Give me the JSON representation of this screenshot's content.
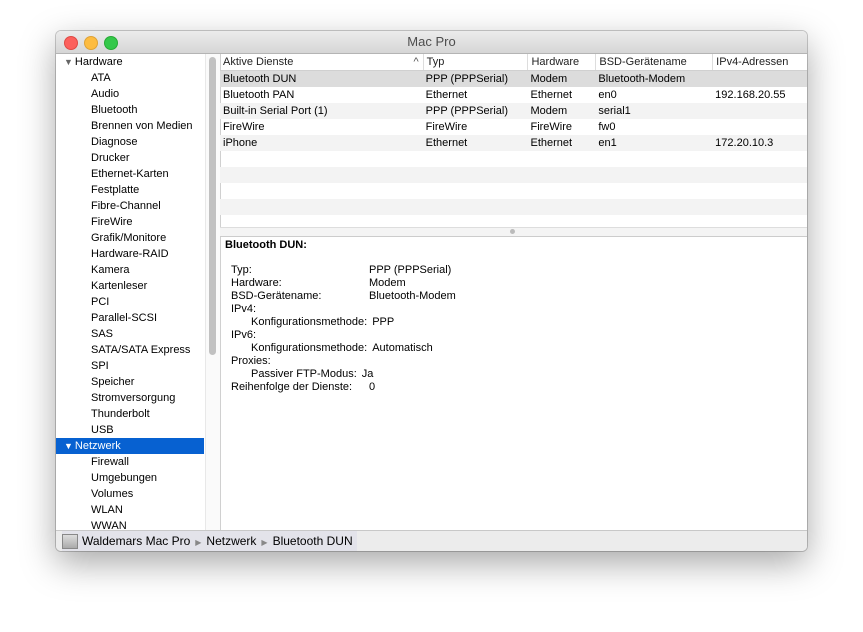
{
  "window": {
    "title": "Mac Pro"
  },
  "sidebar": {
    "items": [
      {
        "label": "Hardware",
        "cat": true
      },
      {
        "label": "ATA"
      },
      {
        "label": "Audio"
      },
      {
        "label": "Bluetooth"
      },
      {
        "label": "Brennen von Medien"
      },
      {
        "label": "Diagnose"
      },
      {
        "label": "Drucker"
      },
      {
        "label": "Ethernet-Karten"
      },
      {
        "label": "Festplatte"
      },
      {
        "label": "Fibre-Channel"
      },
      {
        "label": "FireWire"
      },
      {
        "label": "Grafik/Monitore"
      },
      {
        "label": "Hardware-RAID"
      },
      {
        "label": "Kamera"
      },
      {
        "label": "Kartenleser"
      },
      {
        "label": "PCI"
      },
      {
        "label": "Parallel-SCSI"
      },
      {
        "label": "SAS"
      },
      {
        "label": "SATA/SATA Express"
      },
      {
        "label": "SPI"
      },
      {
        "label": "Speicher"
      },
      {
        "label": "Stromversorgung"
      },
      {
        "label": "Thunderbolt"
      },
      {
        "label": "USB"
      },
      {
        "label": "Netzwerk",
        "cat": true,
        "selected": true
      },
      {
        "label": "Firewall"
      },
      {
        "label": "Umgebungen"
      },
      {
        "label": "Volumes"
      },
      {
        "label": "WLAN"
      },
      {
        "label": "WWAN"
      }
    ]
  },
  "table": {
    "headers": [
      "Aktive Dienste",
      "Typ",
      "Hardware",
      "BSD-Gerätename",
      "IPv4-Adressen"
    ],
    "rows": [
      [
        "Bluetooth DUN",
        "PPP (PPPSerial)",
        "Modem",
        "Bluetooth-Modem",
        ""
      ],
      [
        "Bluetooth PAN",
        "Ethernet",
        "Ethernet",
        "en0",
        "192.168.20.55"
      ],
      [
        "Built-in Serial Port (1)",
        "PPP (PPPSerial)",
        "Modem",
        "serial1",
        ""
      ],
      [
        "FireWire",
        "FireWire",
        "FireWire",
        "fw0",
        ""
      ],
      [
        "iPhone",
        "Ethernet",
        "Ethernet",
        "en1",
        "172.20.10.3"
      ]
    ]
  },
  "detail": {
    "title": "Bluetooth DUN:",
    "lines": [
      [
        "Typ:",
        "PPP (PPPSerial)",
        0
      ],
      [
        "Hardware:",
        "Modem",
        0
      ],
      [
        "BSD-Gerätename:",
        "Bluetooth-Modem",
        0
      ],
      [
        "IPv4:",
        "",
        0
      ],
      [
        "Konfigurationsmethode:",
        "PPP",
        1
      ],
      [
        "IPv6:",
        "",
        0
      ],
      [
        "Konfigurationsmethode:",
        "Automatisch",
        1
      ],
      [
        "Proxies:",
        "",
        0
      ],
      [
        "Passiver FTP-Modus:",
        "Ja",
        1
      ],
      [
        "Reihenfolge der Dienste:",
        "0",
        0
      ]
    ]
  },
  "status": {
    "path": [
      "Waldemars Mac Pro",
      "Netzwerk",
      "Bluetooth DUN"
    ]
  }
}
